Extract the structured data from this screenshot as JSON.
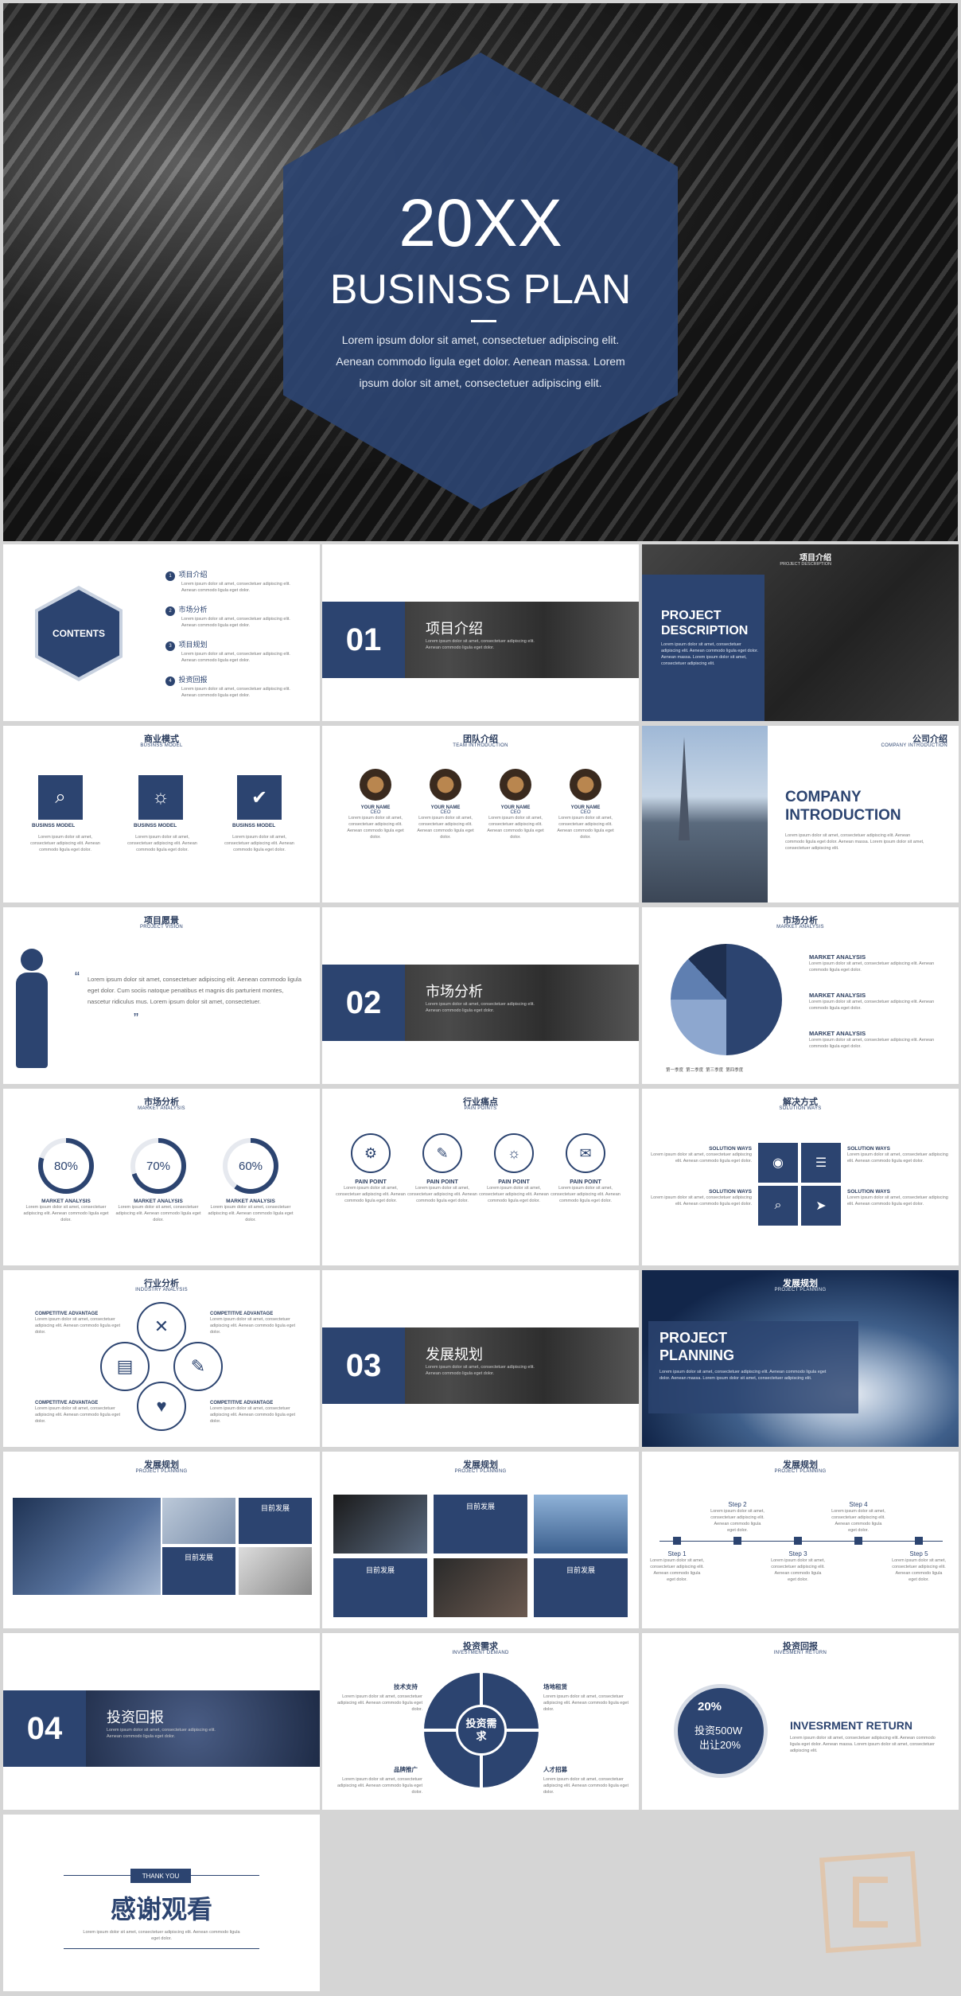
{
  "cover": {
    "year": "20XX",
    "title": "BUSINSS PLAN",
    "body": "Lorem ipsum dolor sit amet, consectetuer adipiscing elit. Aenean commodo ligula eget dolor. Aenean massa. Lorem ipsum dolor sit amet, consectetuer adipiscing elit."
  },
  "lorem": "Lorem ipsum dolor sit amet, consectetuer adipiscing elit. Aenean commodo ligula eget dolor.",
  "contents": {
    "badge": "CONTENTS",
    "items": [
      "项目介绍",
      "市场分析",
      "项目规划",
      "投资回报"
    ],
    "nums": [
      "1",
      "2",
      "3",
      "4"
    ]
  },
  "sec1": {
    "num": "01",
    "title": "项目介绍"
  },
  "projdesc": {
    "cn": "项目介绍",
    "en": "PROJECT DESCRIPTION",
    "big": "PROJECT DESCRIPTION"
  },
  "bizmodel": {
    "cn": "商业模式",
    "en": "BUSINSS MODEL",
    "items": [
      "BUSINSS MODEL",
      "BUSINSS MODEL",
      "BUSINSS MODEL"
    ]
  },
  "team": {
    "cn": "团队介绍",
    "en": "TEAM INTRODUCTION",
    "name": "YOUR NAME",
    "role": "CEO"
  },
  "company": {
    "cn": "公司介绍",
    "en": "COMPANY INTRODUCTION",
    "big": "COMPANY INTRODUCTION"
  },
  "vision": {
    "cn": "项目愿景",
    "en": "PROJECT VISION",
    "quote": "Lorem ipsum dolor sit amet, consectetuer adipiscing elit. Aenean commodo ligula eget dolor. Cum sociis natoque penatibus et magnis dis parturient montes, nascetur ridiculus mus. Lorem ipsum dolor sit amet, consectetuer."
  },
  "sec2": {
    "num": "02",
    "title": "市场分析"
  },
  "market1": {
    "cn": "市场分析",
    "en": "MARKET ANALYSIS",
    "item": "MARKET ANALYSIS",
    "legend": [
      "第一季度",
      "第二季度",
      "第三季度",
      "第四季度"
    ]
  },
  "market2": {
    "cn": "市场分析",
    "en": "MARKET ANALYSIS",
    "pcts": [
      "80%",
      "70%",
      "60%"
    ],
    "label": "MARKET ANALYSIS"
  },
  "pain": {
    "cn": "行业痛点",
    "en": "PAIN POINTS",
    "label": "PAIN POINT"
  },
  "solution": {
    "cn": "解决方式",
    "en": "SOLUTION WAYS",
    "label": "SOLUTION WAYS"
  },
  "industry": {
    "cn": "行业分析",
    "en": "INDUSTRY ANALYSIS",
    "label": "COMPETITIVE ADVANTAGE"
  },
  "sec3": {
    "num": "03",
    "title": "发展规划"
  },
  "planning": {
    "cn": "发展规划",
    "en": "PROJECT PLANNING",
    "big": "PROJECT PLANNING"
  },
  "dev": {
    "cn": "发展规划",
    "en": "PROJECT PLANNING",
    "box": "目前发展"
  },
  "steps": {
    "cn": "发展规划",
    "en": "PROJECT PLANNING",
    "items": [
      "Step 1",
      "Step 2",
      "Step 3",
      "Step 4",
      "Step 5"
    ]
  },
  "sec4": {
    "num": "04",
    "title": "投资回报"
  },
  "invest": {
    "cn": "投资需求",
    "en": "INVESTMENT DEMAND",
    "center": "投资需求",
    "items": [
      "技术支持",
      "场地租赁",
      "品牌推广",
      "人才招募"
    ]
  },
  "return": {
    "cn": "投资回报",
    "en": "INVESMENT RETURN",
    "pct": "20%",
    "l1": "投资500W",
    "l2": "出让20%",
    "big": "INVESRMENT RETURN"
  },
  "thanks": {
    "tag": "THANK YOU",
    "big": "感谢观看"
  },
  "colors": {
    "navy": "#2c4470",
    "light": "#8da7cf"
  }
}
